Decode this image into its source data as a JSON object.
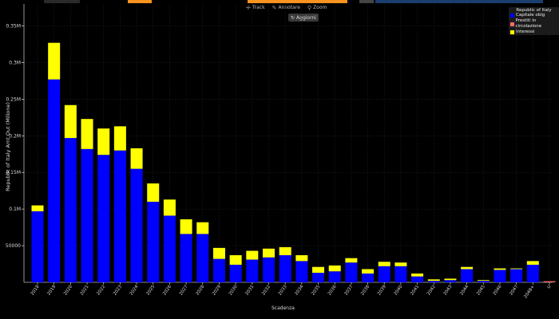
{
  "toolbar": {
    "track_label": "Track",
    "zoom_out_label": "Annotare",
    "zoom_label": "Zoom",
    "refresh_label": "Aggiorni"
  },
  "colors": {
    "capitale": "#0000ff",
    "prestiti": "#ff6a6a",
    "interessi": "#ffff00",
    "top_orange": "#f7931e",
    "top_blue": "#1a3f6e"
  },
  "chart_data": {
    "type": "bar",
    "stacked": true,
    "legend_title": "Republic of Italy",
    "legend_placement": "top-right",
    "grid": true,
    "ylabel": "Republic of Italy Amt Out (Milione)",
    "xlabel": "Scadenza",
    "ylim": [
      0,
      380000
    ],
    "yticks": [
      {
        "value": 50000,
        "label": "50000"
      },
      {
        "value": 100000,
        "label": "0.1M"
      },
      {
        "value": 150000,
        "label": "0.15M"
      },
      {
        "value": 200000,
        "label": "0.2M"
      },
      {
        "value": 250000,
        "label": "0.25M"
      },
      {
        "value": 300000,
        "label": "0.3M"
      },
      {
        "value": 350000,
        "label": "0.35M"
      }
    ],
    "categories": [
      "2018",
      "2019",
      "2020",
      "2021",
      "2022",
      "2023",
      "2024",
      "2025",
      "2026",
      "2027",
      "2028",
      "2029",
      "2030",
      "2031",
      "2032",
      "2033",
      "2034",
      "2035",
      "2036",
      "2037",
      "2038",
      "2039",
      "2040",
      "2041",
      "2042",
      "2043",
      "2044",
      "2045",
      "2046",
      "2047",
      "2048+",
      "U"
    ],
    "series": [
      {
        "name": "Capitale oblg",
        "color": "#0000ff",
        "values": [
          97000,
          277000,
          197000,
          182000,
          174000,
          180000,
          155000,
          110000,
          91000,
          66000,
          66000,
          32000,
          24000,
          31000,
          34000,
          37000,
          29000,
          13000,
          15000,
          27000,
          12000,
          22000,
          22000,
          8000,
          2000,
          3000,
          18000,
          2000,
          17000,
          18000,
          24000,
          0
        ]
      },
      {
        "name": "Prestiti in circolazione",
        "color": "#ff6a6a",
        "values": [
          0,
          0,
          0,
          0,
          0,
          0,
          0,
          0,
          0,
          0,
          0,
          0,
          0,
          0,
          0,
          0,
          0,
          0,
          0,
          0,
          0,
          0,
          0,
          0,
          0,
          0,
          0,
          0,
          0,
          0,
          0,
          1500
        ]
      },
      {
        "name": "Interessi",
        "color": "#ffff00",
        "values": [
          8000,
          50000,
          45000,
          41000,
          36000,
          33000,
          28000,
          25000,
          22000,
          20000,
          16000,
          15000,
          13000,
          12000,
          12000,
          11000,
          8000,
          8000,
          8000,
          6000,
          6000,
          6000,
          5000,
          4000,
          2000,
          2000,
          3000,
          1000,
          2000,
          1000,
          5000,
          0
        ]
      }
    ]
  }
}
